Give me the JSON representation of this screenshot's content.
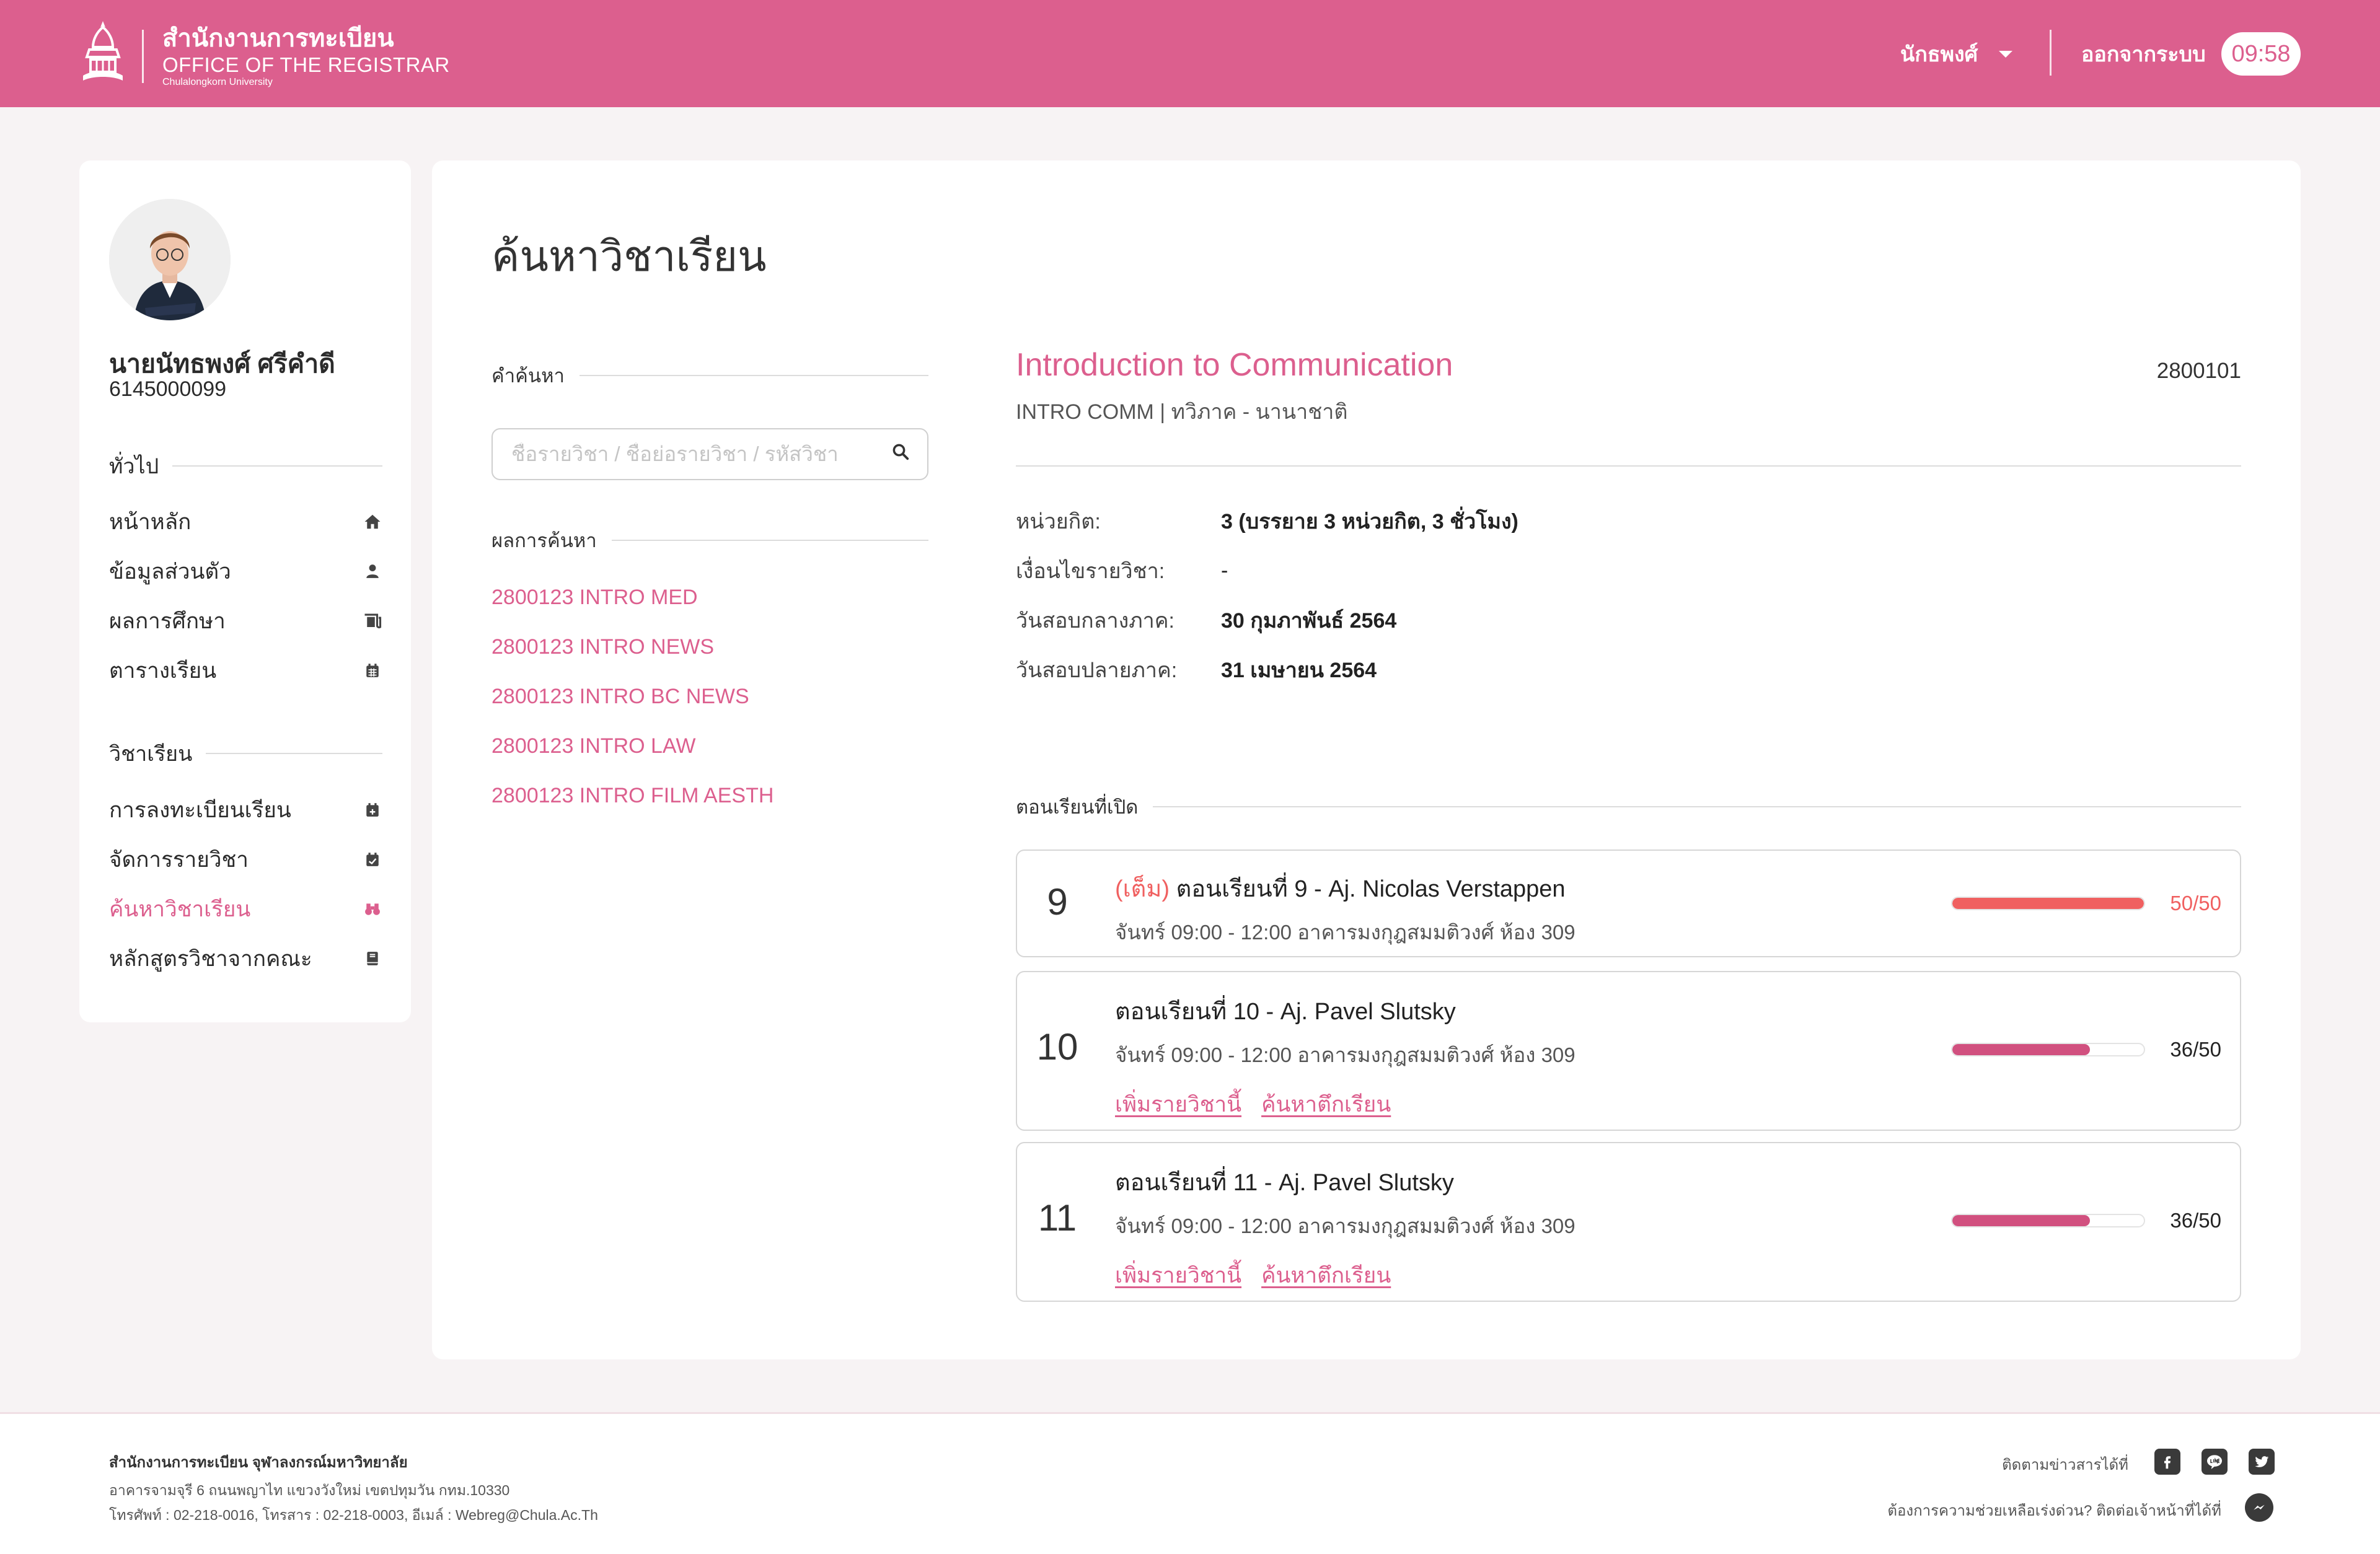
{
  "header": {
    "org_th": "สำนักงานการทะเบียน",
    "org_en": "OFFICE OF THE REGISTRAR",
    "university": "Chulalongkorn University",
    "user": "นักธพงศ์",
    "logout": "ออกจากระบบ",
    "clock": "09:58",
    "brand_color": "#DC5F8E"
  },
  "sidebar": {
    "name": "นายนัทธพงศ์ ศรีคำดี",
    "student_id": "6145000099",
    "general_heading": "ทั่วไป",
    "general_items": [
      {
        "label": "หน้าหลัก",
        "icon": "home-icon"
      },
      {
        "label": "ข้อมูลส่วนตัว",
        "icon": "user-icon"
      },
      {
        "label": "ผลการศึกษา",
        "icon": "transcript-icon"
      },
      {
        "label": "ตารางเรียน",
        "icon": "calendar-icon"
      }
    ],
    "course_heading": "วิชาเรียน",
    "course_items": [
      {
        "label": "การลงทะเบียนเรียน",
        "icon": "calendar-plus-icon"
      },
      {
        "label": "จัดการรายวิชา",
        "icon": "calendar-check-icon"
      },
      {
        "label": "ค้นหาวิชาเรียน",
        "icon": "binoculars-icon",
        "active": true
      },
      {
        "label": "หลักสูตรวิชาจากคณะ",
        "icon": "book-icon"
      }
    ]
  },
  "main": {
    "title": "ค้นหาวิชาเรียน",
    "search": {
      "heading": "คำค้นหา",
      "placeholder": "ชื่อรายวิชา / ชื่อย่อรายวิชา / รหัสวิชา",
      "value": ""
    },
    "results": {
      "heading": "ผลการค้นหา",
      "items": [
        "2800123 INTRO MED",
        "2800123 INTRO NEWS",
        "2800123 INTRO BC NEWS",
        "2800123 INTRO LAW",
        "2800123 INTRO FILM AESTH"
      ]
    },
    "course": {
      "title": "Introduction to Communication",
      "code": "2800101",
      "subtitle": "INTRO COMM | ทวิภาค - นานาชาติ",
      "info": [
        {
          "label": "หน่วยกิต:",
          "value": "3 (บรรยาย 3 หน่วยกิต, 3 ชั่วโมง)"
        },
        {
          "label": "เงื่อนไขรายวิชา:",
          "value": "-"
        },
        {
          "label": "วันสอบกลางภาค:",
          "value": "30 กุมภาพันธ์ 2564"
        },
        {
          "label": "วันสอบปลายภาค:",
          "value": "31 เมษายน 2564"
        }
      ]
    },
    "sections_heading": "ตอนเรียนที่เปิด",
    "sections": [
      {
        "number": "9",
        "full_tag": "(เต็ม)",
        "title": "ตอนเรียนที่ 9 - Aj. Nicolas Verstappen",
        "time": "จันทร์ 09:00 - 12:00 อาคารมงกุฎสมมติวงศ์ ห้อง 309",
        "count": "50/50",
        "fill": 1.0,
        "full": true
      },
      {
        "number": "10",
        "title": "ตอนเรียนที่ 10 - Aj. Pavel Slutsky",
        "time": "จันทร์ 09:00 - 12:00 อาคารมงกุฎสมมติวงศ์ ห้อง 309",
        "count": "36/50",
        "fill": 0.72,
        "add_label": "เพิ่มรายวิชานี้",
        "building_label": "ค้นหาตึกเรียน"
      },
      {
        "number": "11",
        "title": "ตอนเรียนที่ 11 - Aj. Pavel Slutsky",
        "time": "จันทร์ 09:00 - 12:00 อาคารมงกุฎสมมติวงศ์ ห้อง 309",
        "count": "36/50",
        "fill": 0.72,
        "add_label": "เพิ่มรายวิชานี้",
        "building_label": "ค้นหาตึกเรียน"
      }
    ]
  },
  "footer": {
    "org": "สำนักงานการทะเบียน จุฬาลงกรณ์มหาวิทยาลัย",
    "address": "อาคารจามจุรี 6 ถนนพญาไท แขวงวังใหม่ เขตปทุมวัน กทม.10330",
    "contact": "โทรศัพท์ : 02-218-0016, โทรสาร : 02-218-0003, อีเมล์ : Webreg@Chula.Ac.Th",
    "follow": "ติดตามข่าวสารได้ที่",
    "help": "ต้องการความช่วยเหลือเร่งด่วน? ติดต่อเจ้าหน้าที่ได้ที่"
  }
}
